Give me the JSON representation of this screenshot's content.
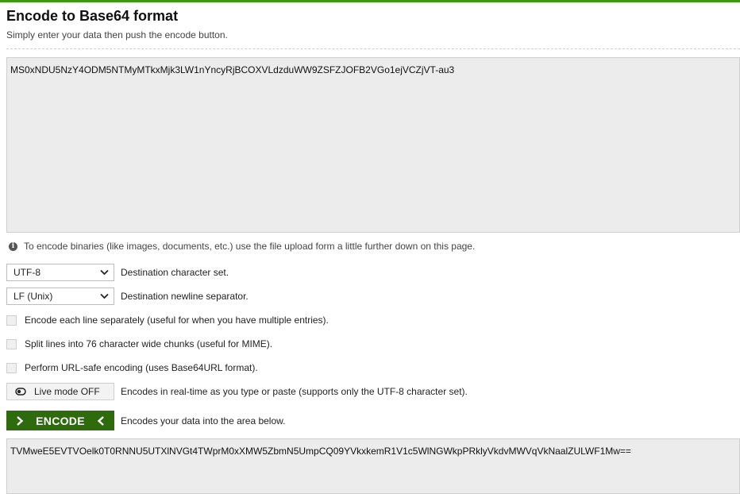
{
  "header": {
    "title": "Encode to Base64 format",
    "subtitle": "Simply enter your data then push the encode button."
  },
  "input": {
    "value": "MS0xNDU5NzY4ODM5NTMyMTkxMjk3LW1nYncyRjBCOXVLdzduWW9ZSFZJOFB2VGo1ejVCZjVT-au3"
  },
  "note": {
    "icon": "info-icon",
    "text": "To encode binaries (like images, documents, etc.) use the file upload form a little further down on this page."
  },
  "options": {
    "charset": {
      "selected": "UTF-8",
      "description": "Destination character set."
    },
    "newline": {
      "selected": "LF (Unix)",
      "description": "Destination newline separator."
    },
    "each_line": {
      "checked": false,
      "label": "Encode each line separately (useful for when you have multiple entries)."
    },
    "split_lines": {
      "checked": false,
      "label": "Split lines into 76 character wide chunks (useful for MIME)."
    },
    "url_safe": {
      "checked": false,
      "label": "Perform URL-safe encoding (uses Base64URL format)."
    },
    "live_mode": {
      "label": "Live mode OFF",
      "description": "Encodes in real-time as you type or paste (supports only the UTF-8 character set)."
    }
  },
  "encode": {
    "label": "ENCODE",
    "description": "Encodes your data into the area below."
  },
  "output": {
    "value": "TVMweE5EVTVOelk0T0RNNU5UTXlNVGt4TWprM0xXMW5ZbmN5UmpCQ09YVkxkemR1V1c5WlNGWkpPRklyVkdvMWVqVkNaalZULWF1Mw=="
  },
  "colors": {
    "accent_bar": "#3b9a10",
    "encode_button": "#2e6b0c",
    "textarea_bg": "#ececec"
  }
}
